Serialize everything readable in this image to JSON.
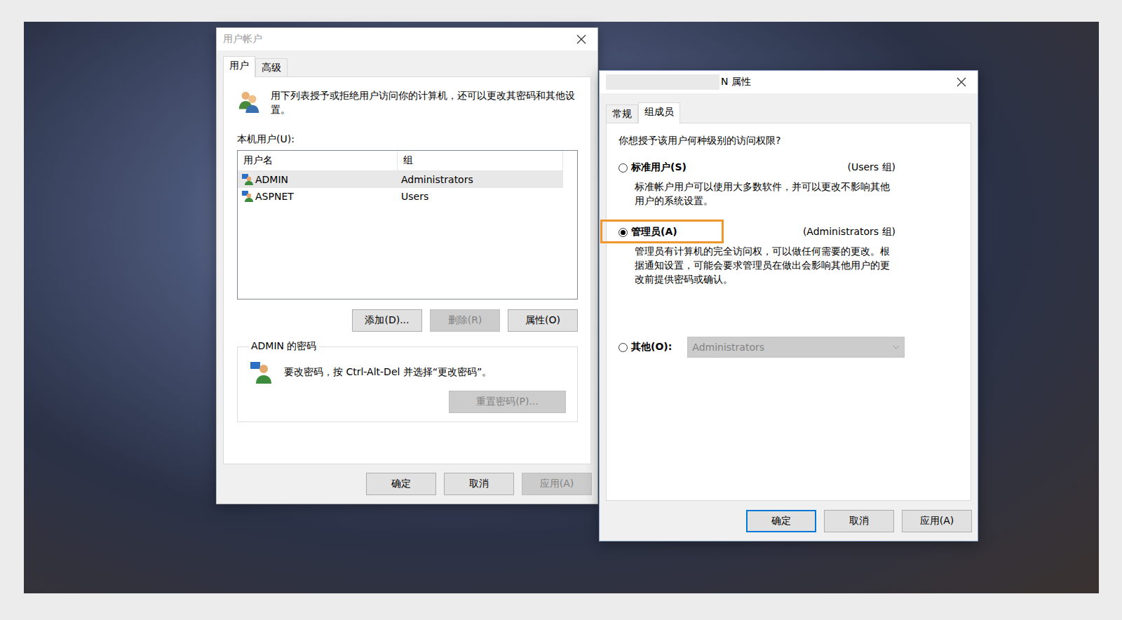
{
  "user_accounts": {
    "title": "用户帐户",
    "active": false,
    "tabs": [
      {
        "label": "用户",
        "selected": true
      },
      {
        "label": "高级",
        "selected": false
      }
    ],
    "description": "用下列表授予或拒绝用户访问你的计算机，还可以更改其密码和其他设置。",
    "users_label": "本机用户(U):",
    "columns": [
      "用户名",
      "组"
    ],
    "rows": [
      {
        "name": "ADMIN",
        "group": "Administrators",
        "selected": true
      },
      {
        "name": "ASPNET",
        "group": "Users",
        "selected": false
      }
    ],
    "list_buttons": [
      {
        "label": "添加(D)...",
        "disabled": false
      },
      {
        "label": "删除(R)",
        "disabled": true
      },
      {
        "label": "属性(O)",
        "disabled": false
      }
    ],
    "password_group": {
      "title": "ADMIN 的密码",
      "text": "要改密码，按 Ctrl-Alt-Del 并选择“更改密码”。",
      "button": {
        "label": "重置密码(P)...",
        "disabled": true
      }
    },
    "buttons": [
      {
        "label": "确定",
        "disabled": false,
        "default": false
      },
      {
        "label": "取消",
        "disabled": false,
        "default": false
      },
      {
        "label": "应用(A)",
        "disabled": true,
        "default": false
      }
    ]
  },
  "properties": {
    "title": "N 属性",
    "title_redacted": true,
    "active": true,
    "tabs": [
      {
        "label": "常规",
        "selected": false
      },
      {
        "label": "组成员",
        "selected": true
      }
    ],
    "question": "你想授予该用户何种级别的访问权限?",
    "options": [
      {
        "label": "标准用户(S)",
        "group": "(Users 组)",
        "description": "标准帐户用户可以使用大多数软件，并可以更改不影响其他用户的系统设置。",
        "selected": false,
        "highlighted": false
      },
      {
        "label": "管理员(A)",
        "group": "(Administrators 组)",
        "description": "管理员有计算机的完全访问权，可以做任何需要的更改。根据通知设置，可能会要求管理员在做出会影响其他用户的更改前提供密码或确认。",
        "selected": true,
        "highlighted": true
      }
    ],
    "other": {
      "label": "其他(O):",
      "selected": false,
      "value": "Administrators",
      "disabled": true
    },
    "buttons": [
      {
        "label": "确定",
        "disabled": false,
        "default": true
      },
      {
        "label": "取消",
        "disabled": false,
        "default": false
      },
      {
        "label": "应用(A)",
        "disabled": false,
        "default": false
      }
    ]
  }
}
